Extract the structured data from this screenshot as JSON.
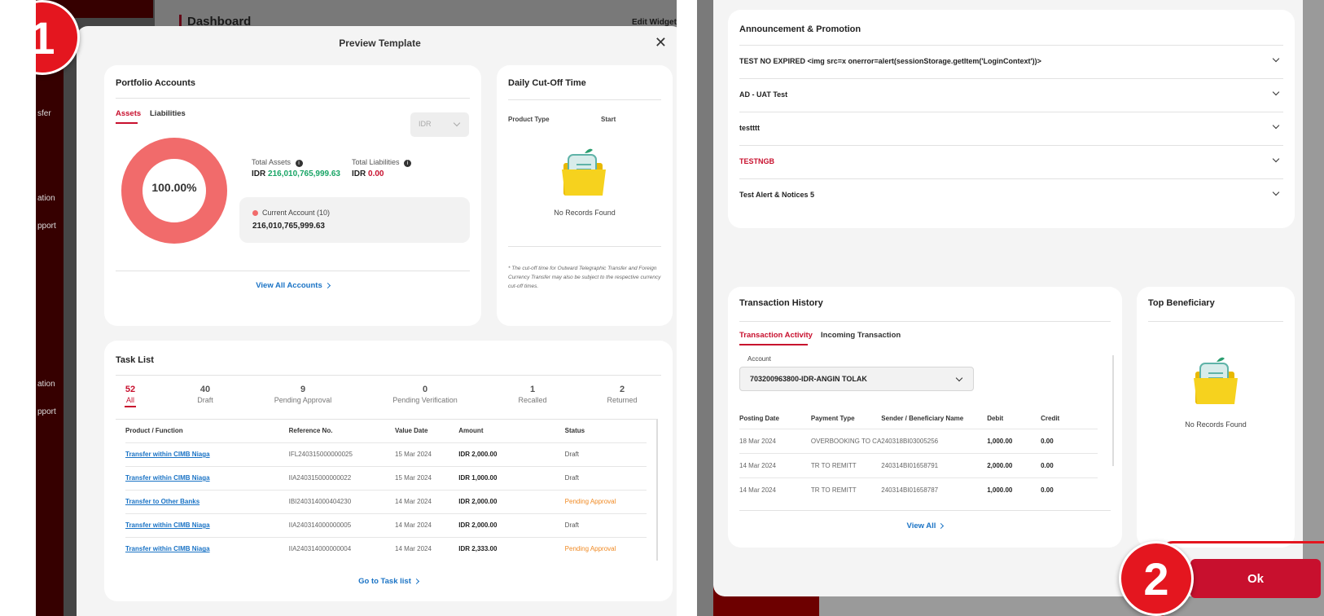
{
  "colors": {
    "brand_red": "#c8102e",
    "positive_green": "#19a566",
    "warning_orange": "#f08a24",
    "link_blue": "#1a73c5"
  },
  "background": {
    "page_title": "Dashboard",
    "edit_widget": "Edit Widget",
    "side_texts": [
      "sfer",
      "ation",
      "pport",
      "ation",
      "pport"
    ]
  },
  "badges": {
    "one": "1",
    "two": "2"
  },
  "modal": {
    "title": "Preview Template"
  },
  "portfolio": {
    "title": "Portfolio Accounts",
    "tabs": [
      "Assets",
      "Liabilities"
    ],
    "currency": "IDR",
    "donut_label": "100.00%",
    "donut_fraction": 1.0,
    "total_assets_label": "Total Assets",
    "total_assets_currency": "IDR",
    "total_assets_value": "216,010,765,999.63",
    "total_liabilities_label": "Total Liabilities",
    "total_liabilities_currency": "IDR",
    "total_liabilities_value": "0.00",
    "account_name": "Current Account (10)",
    "account_value": "216,010,765,999.63",
    "view_all": "View All Accounts"
  },
  "cutoff": {
    "title": "Daily Cut-Off Time",
    "col1": "Product Type",
    "col2": "Start",
    "empty": "No Records Found",
    "note": "* The cut-off time for Outward Telegraphic Transfer and Foreign Currency Transfer may also be subject to the respective currency cut-off times."
  },
  "tasks": {
    "title": "Task List",
    "stats": [
      {
        "count": "52",
        "label": "All"
      },
      {
        "count": "40",
        "label": "Draft"
      },
      {
        "count": "9",
        "label": "Pending Approval"
      },
      {
        "count": "0",
        "label": "Pending Verification"
      },
      {
        "count": "1",
        "label": "Recalled"
      },
      {
        "count": "2",
        "label": "Returned"
      }
    ],
    "headers": [
      "Product / Function",
      "Reference No.",
      "Value Date",
      "Amount",
      "Status"
    ],
    "rows": [
      {
        "product": "Transfer within CIMB Niaga",
        "ref": "IFL240315000000025",
        "date": "15 Mar 2024",
        "amount": "IDR 2,000.00",
        "status": "Draft"
      },
      {
        "product": "Transfer within CIMB Niaga",
        "ref": "IIA240315000000022",
        "date": "15 Mar 2024",
        "amount": "IDR 1,000.00",
        "status": "Draft"
      },
      {
        "product": "Transfer to Other Banks",
        "ref": "IBI240314000404230",
        "date": "14 Mar 2024",
        "amount": "IDR 2,000.00",
        "status": "Pending Approval"
      },
      {
        "product": "Transfer within CIMB Niaga",
        "ref": "IIA240314000000005",
        "date": "14 Mar 2024",
        "amount": "IDR 2,000.00",
        "status": "Draft"
      },
      {
        "product": "Transfer within CIMB Niaga",
        "ref": "IIA240314000000004",
        "date": "14 Mar 2024",
        "amount": "IDR 2,333.00",
        "status": "Pending Approval"
      }
    ],
    "go_to": "Go to Task list"
  },
  "announcements": {
    "title": "Announcement & Promotion",
    "items": [
      "TEST NO EXPIRED <img src=x onerror=alert(sessionStorage.getItem('LoginContext'))>",
      "AD - UAT Test",
      "testttt",
      "TESTNGB",
      "Test Alert & Notices 5"
    ]
  },
  "history": {
    "title": "Transaction History",
    "tabs": [
      "Transaction Activity",
      "Incoming Transaction"
    ],
    "account_label": "Account",
    "account_value": "703200963800-IDR-ANGIN TOLAK",
    "headers": [
      "Posting Date",
      "Payment Type",
      "Sender / Beneficiary Name",
      "Debit",
      "Credit"
    ],
    "rows": [
      {
        "date": "18 Mar 2024",
        "type": "OVERBOOKING TO CA",
        "name": "240318BI03005256",
        "debit": "1,000.00",
        "credit": "0.00"
      },
      {
        "date": "14 Mar 2024",
        "type": "TR TO REMITT",
        "name": "240314BI01658791",
        "debit": "2,000.00",
        "credit": "0.00"
      },
      {
        "date": "14 Mar 2024",
        "type": "TR TO REMITT",
        "name": "240314BI01658787",
        "debit": "1,000.00",
        "credit": "0.00"
      }
    ],
    "view_all": "View All"
  },
  "beneficiary": {
    "title": "Top Beneficiary",
    "empty": "No Records Found"
  },
  "ok_button": "Ok"
}
